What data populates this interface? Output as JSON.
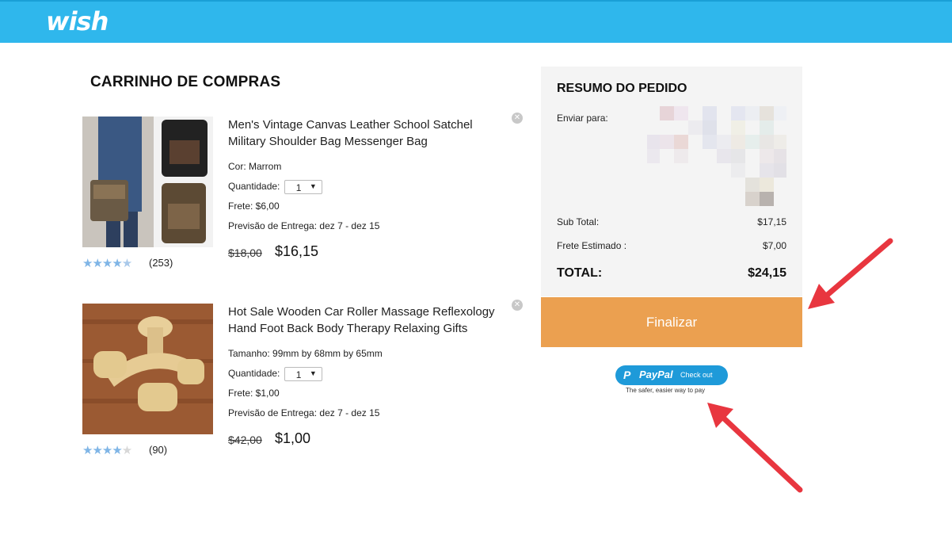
{
  "header": {
    "logo": "wish",
    "color": "#2fb7ec"
  },
  "cart": {
    "title": "CARRINHO DE COMPRAS",
    "items": [
      {
        "name": "Men's Vintage Canvas Leather School Satchel Military Shoulder Bag Messenger Bag",
        "option_label": "Cor: Marrom",
        "quantity_label": "Quantidade:",
        "quantity": "1",
        "shipping": "Frete: $6,00",
        "delivery": "Previsão de Entrega: dez 7 - dez 15",
        "old_price": "$18,00",
        "price": "$16,15",
        "rating": 4.5,
        "reviews": "(253)"
      },
      {
        "name": "Hot Sale Wooden Car Roller Massage Reflexology Hand Foot Back Body Therapy Relaxing Gifts",
        "option_label": "Tamanho: 99mm by 68mm by 65mm",
        "quantity_label": "Quantidade:",
        "quantity": "1",
        "shipping": "Frete: $1,00",
        "delivery": "Previsão de Entrega: dez 7 - dez 15",
        "old_price": "$42,00",
        "price": "$1,00",
        "rating": 4,
        "reviews": "(90)"
      }
    ]
  },
  "summary": {
    "title": "RESUMO DO PEDIDO",
    "ship_to_label": "Enviar para:",
    "subtotal_label": "Sub Total:",
    "subtotal": "$17,15",
    "shipping_label": "Frete Estimado :",
    "shipping": "$7,00",
    "total_label": "TOTAL:",
    "total": "$24,15",
    "checkout_label": "Finalizar",
    "checkout_color": "#eba050"
  },
  "paypal": {
    "brand": "PayPal",
    "action": "Check out",
    "tagline": "The safer, easier way to pay"
  },
  "icons": {
    "remove": "close-circle-icon",
    "arrow": "red-arrow-annotation"
  }
}
